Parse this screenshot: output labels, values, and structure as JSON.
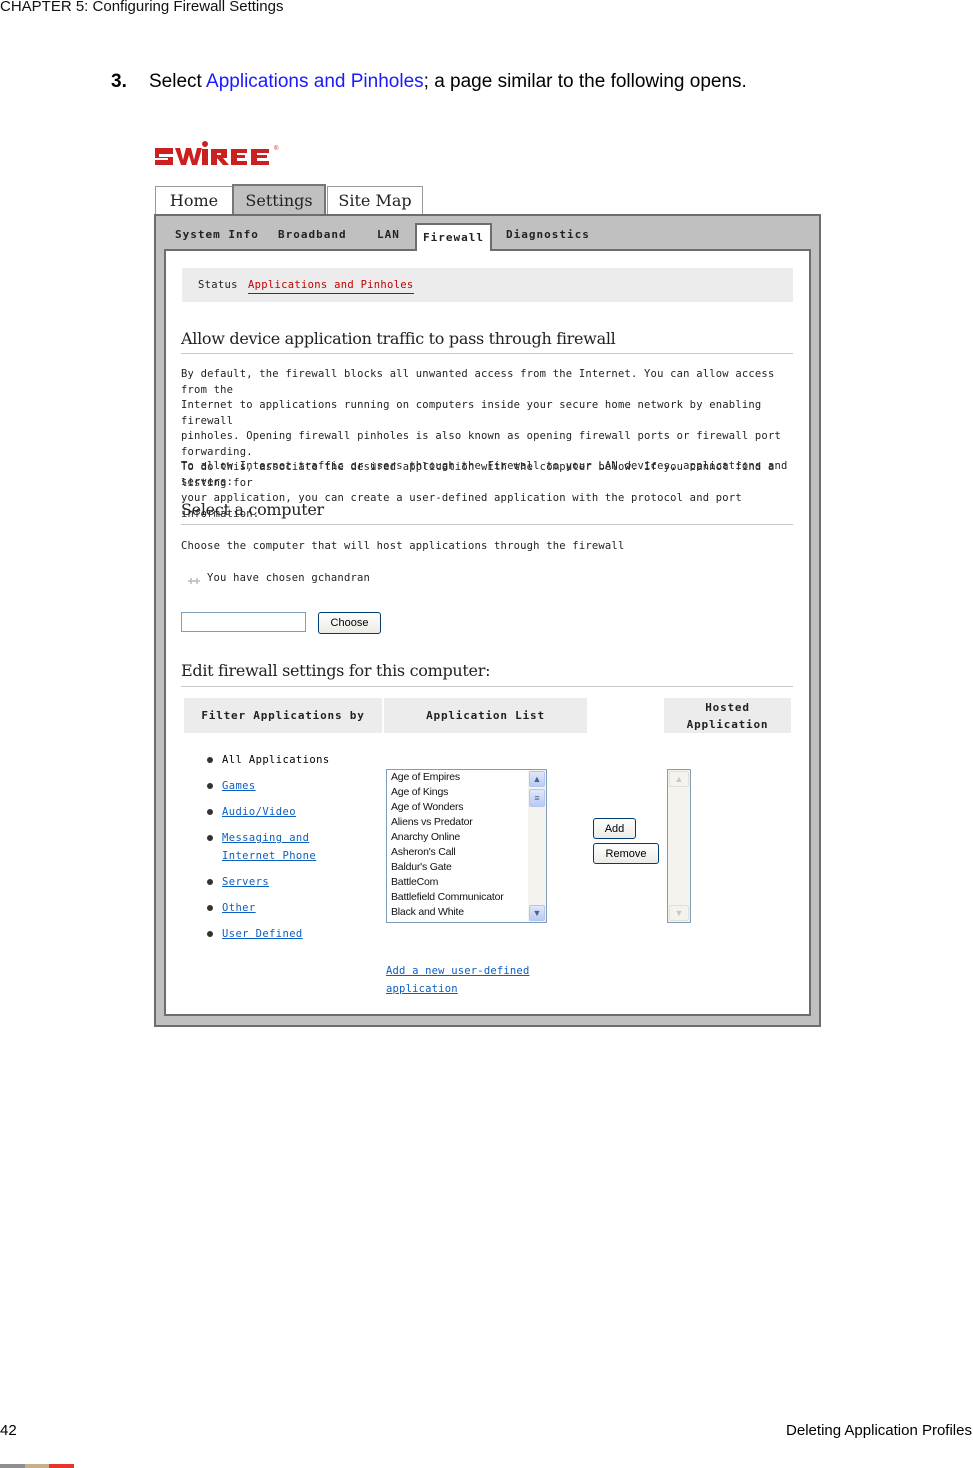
{
  "document": {
    "running_head": "CHAPTER 5: Configuring Firewall Settings",
    "step": {
      "number": "3.",
      "text_before": "Select ",
      "link_text": "Applications and Pinholes",
      "text_after": "; a page similar to the following opens."
    },
    "footer": {
      "page_number": "42",
      "section_title": "Deleting Application Profiles",
      "color_bar": [
        "#8f8f8f",
        "#c8b08a",
        "#e8352a"
      ]
    }
  },
  "app": {
    "brand": {
      "logo_text": "2WIRE",
      "registered": "®",
      "color": "#cc1f1f"
    },
    "main_tabs": [
      {
        "label": "Home",
        "active": false
      },
      {
        "label": "Settings",
        "active": true
      },
      {
        "label": "Site Map",
        "active": false
      }
    ],
    "sub_tabs": [
      {
        "label": "System Info",
        "active": false
      },
      {
        "label": "Broadband",
        "active": false
      },
      {
        "label": "LAN",
        "active": false
      },
      {
        "label": "Firewall",
        "active": true
      },
      {
        "label": "Diagnostics",
        "active": false
      }
    ],
    "sub_nav": [
      {
        "label": "Status",
        "active": false
      },
      {
        "label": "Applications and Pinholes",
        "active": true
      }
    ],
    "section1": {
      "heading": "Allow device application traffic to pass through firewall",
      "paragraph_lines": [
        "By default, the firewall blocks all unwanted access from the Internet. You can allow access from the",
        "Internet to applications running on computers inside your secure home network by enabling firewall",
        "pinholes. Opening firewall pinholes is also known as opening firewall ports or firewall port forwarding.",
        "To do this, associate the desired application with the computer below. If you cannot find a listing for",
        "your application, you can create a user-defined application with the protocol and port information."
      ],
      "instruction": "To allow Internet traffic or users through the Firewall to your LAN devices, applications and servers:"
    },
    "section2": {
      "heading": "Select a computer",
      "instruction": "Choose the computer that will host applications through the firewall",
      "chosen_text": "You have chosen gchandran",
      "computer_input": {
        "value": "",
        "placeholder": ""
      },
      "choose_button": "Choose"
    },
    "section3": {
      "heading": "Edit firewall settings for this computer:",
      "columns": {
        "filter": "Filter Applications by",
        "app_list": "Application List",
        "hosted": "Hosted Application"
      },
      "filters": [
        {
          "label": "All Applications",
          "link": false
        },
        {
          "label": "Games",
          "link": true
        },
        {
          "label": "Audio/Video",
          "link": true
        },
        {
          "label": "Messaging and Internet Phone",
          "link": true
        },
        {
          "label": "Servers",
          "link": true
        },
        {
          "label": "Other",
          "link": true
        },
        {
          "label": "User Defined",
          "link": true
        }
      ],
      "applications": [
        "Age of Empires",
        "Age of Kings",
        "Age of Wonders",
        "Aliens vs Predator",
        "Anarchy Online",
        "Asheron's Call",
        "Baldur's Gate",
        "BattleCom",
        "Battlefield Communicator",
        "Black and White"
      ],
      "hosted_applications": [],
      "add_button": "Add",
      "remove_button": "Remove",
      "add_user_defined_link": "Add a new user-defined application"
    }
  }
}
